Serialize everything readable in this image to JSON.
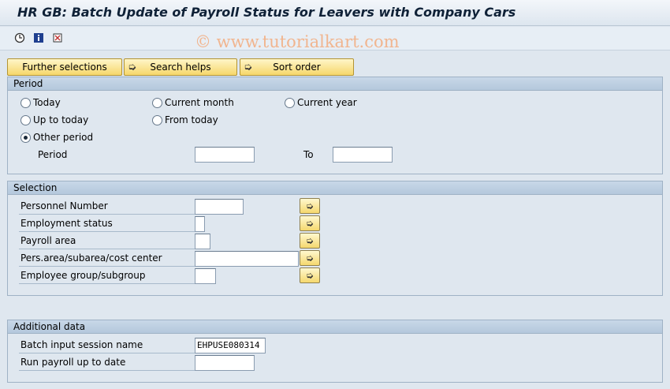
{
  "window": {
    "title": "HR GB: Batch Update of Payroll Status for Leavers with Company Cars"
  },
  "toolbar": {
    "icons": [
      "execute-icon",
      "info-icon",
      "selection-options-icon"
    ],
    "watermark": "© www.tutorialkart.com"
  },
  "buttons": {
    "further_selections": "Further selections",
    "search_helps": "Search helps",
    "sort_order": "Sort order"
  },
  "period": {
    "header": "Period",
    "options": {
      "today": "Today",
      "current_month": "Current month",
      "current_year": "Current year",
      "up_to_today": "Up to today",
      "from_today": "From today",
      "other_period": "Other period"
    },
    "selected": "other_period",
    "period_label": "Period",
    "to_label": "To",
    "from_value": "",
    "to_value": ""
  },
  "selection": {
    "header": "Selection",
    "fields": {
      "personnel_number": {
        "label": "Personnel Number",
        "value": ""
      },
      "employment_status": {
        "label": "Employment status",
        "value": ""
      },
      "payroll_area": {
        "label": "Payroll area",
        "value": ""
      },
      "pers_area": {
        "label": "Pers.area/subarea/cost center",
        "value": ""
      },
      "employee_group": {
        "label": "Employee group/subgroup",
        "value": ""
      }
    }
  },
  "additional": {
    "header": "Additional data",
    "fields": {
      "session_name": {
        "label": "Batch input session name",
        "value": "EHPUSE080314"
      },
      "run_payroll": {
        "label": "Run payroll up to date",
        "value": ""
      }
    }
  }
}
